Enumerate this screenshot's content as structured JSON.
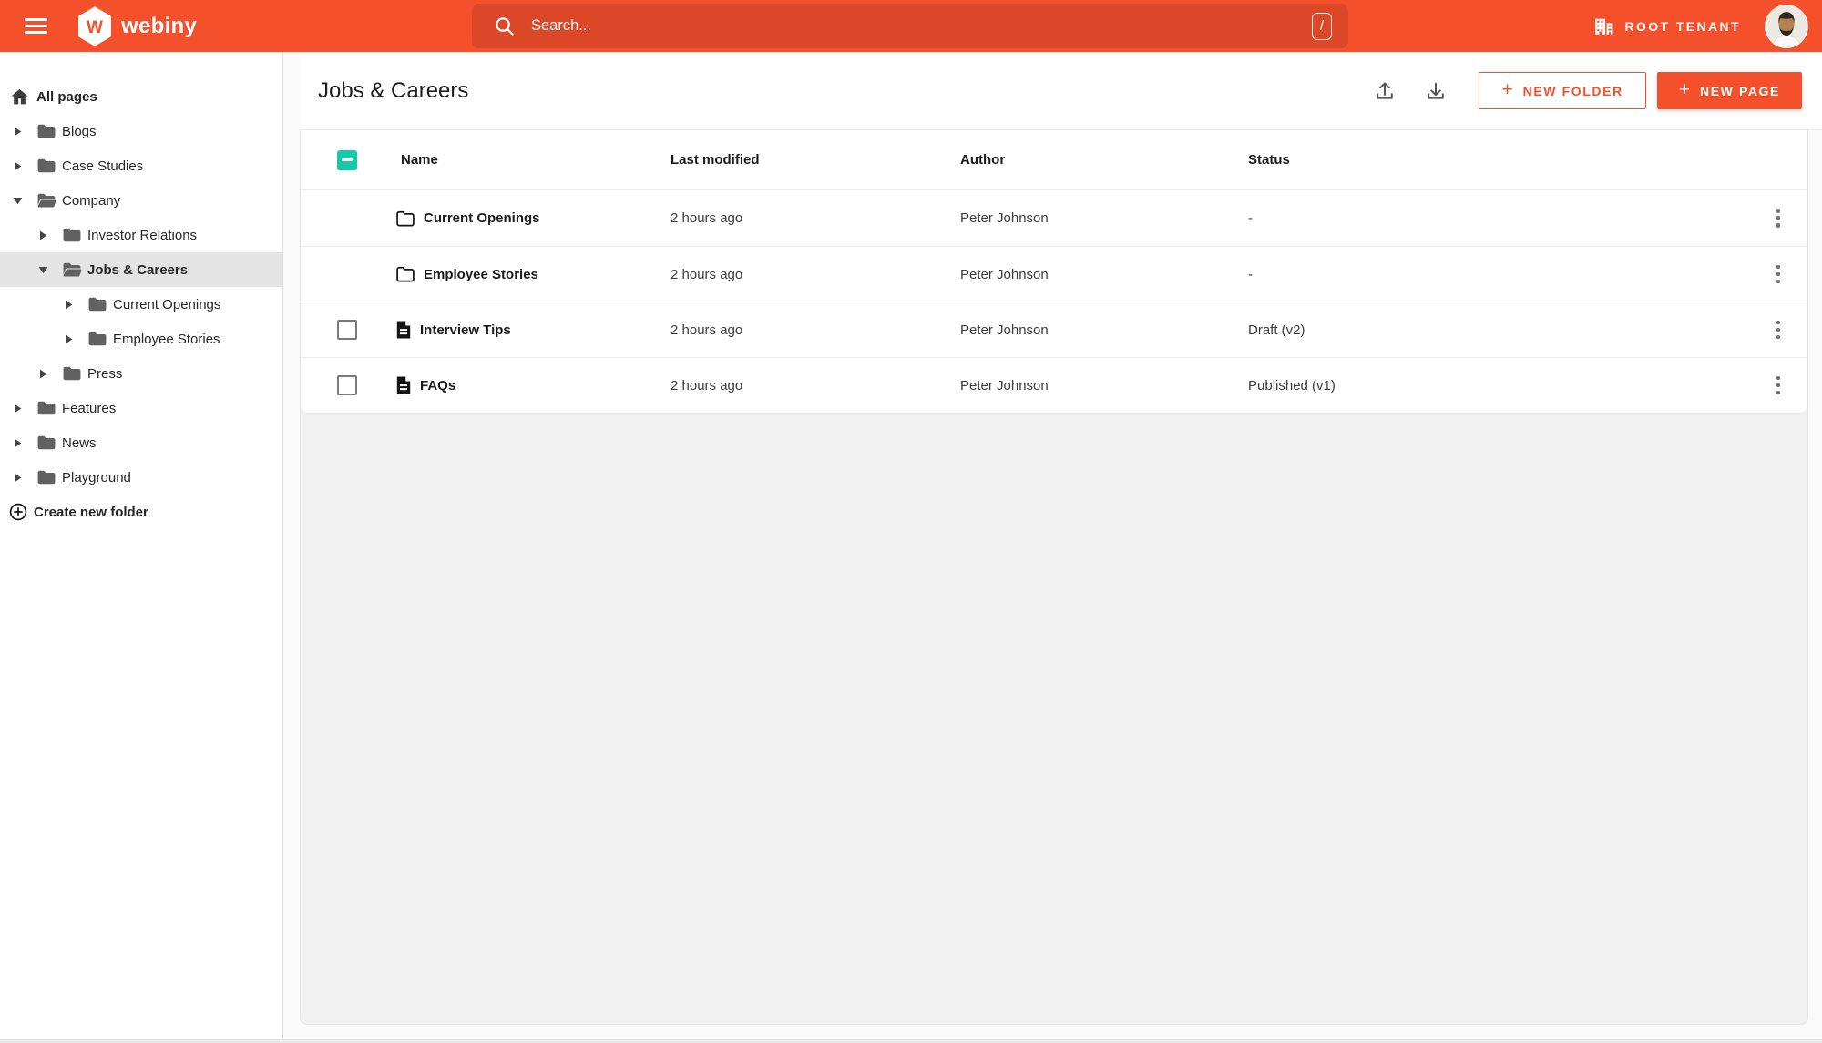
{
  "colors": {
    "brand_orange": "#f4502c",
    "checkbox_teal": "#17c9a7"
  },
  "icons": {
    "plus": "+"
  },
  "appbar": {
    "logo_letter": "W",
    "logo_text": "webiny",
    "search_placeholder": "Search...",
    "search_shortcut": "/",
    "tenant_label": "ROOT TENANT"
  },
  "sidebar": {
    "all_pages_label": "All pages",
    "items": [
      {
        "label": "Blogs",
        "depth": 0,
        "state": "collapsed",
        "selected": false
      },
      {
        "label": "Case Studies",
        "depth": 0,
        "state": "collapsed",
        "selected": false
      },
      {
        "label": "Company",
        "depth": 0,
        "state": "expanded",
        "selected": false
      },
      {
        "label": "Investor Relations",
        "depth": 1,
        "state": "collapsed",
        "selected": false
      },
      {
        "label": "Jobs & Careers",
        "depth": 1,
        "state": "expanded",
        "selected": true
      },
      {
        "label": "Current Openings",
        "depth": 2,
        "state": "collapsed",
        "selected": false
      },
      {
        "label": "Employee Stories",
        "depth": 2,
        "state": "collapsed",
        "selected": false
      },
      {
        "label": "Press",
        "depth": 1,
        "state": "collapsed",
        "selected": false
      },
      {
        "label": "Features",
        "depth": 0,
        "state": "collapsed",
        "selected": false
      },
      {
        "label": "News",
        "depth": 0,
        "state": "collapsed",
        "selected": false
      },
      {
        "label": "Playground",
        "depth": 0,
        "state": "collapsed",
        "selected": false
      }
    ],
    "create_folder_label": "Create new folder"
  },
  "main": {
    "title": "Jobs & Careers",
    "actions": {
      "new_folder_label": "NEW FOLDER",
      "new_page_label": "NEW PAGE"
    },
    "table": {
      "columns": {
        "name": "Name",
        "modified": "Last modified",
        "author": "Author",
        "status": "Status"
      },
      "header_checkbox_state": "indeterminate",
      "rows": [
        {
          "type": "folder",
          "name": "Current Openings",
          "modified": "2 hours ago",
          "author": "Peter Johnson",
          "status": "-"
        },
        {
          "type": "folder",
          "name": "Employee Stories",
          "modified": "2 hours ago",
          "author": "Peter Johnson",
          "status": "-"
        },
        {
          "type": "page",
          "checked": false,
          "name": "Interview Tips",
          "modified": "2 hours ago",
          "author": "Peter Johnson",
          "status": "Draft (v2)"
        },
        {
          "type": "page",
          "checked": false,
          "name": "FAQs",
          "modified": "2 hours ago",
          "author": "Peter Johnson",
          "status": "Published (v1)"
        }
      ]
    }
  }
}
